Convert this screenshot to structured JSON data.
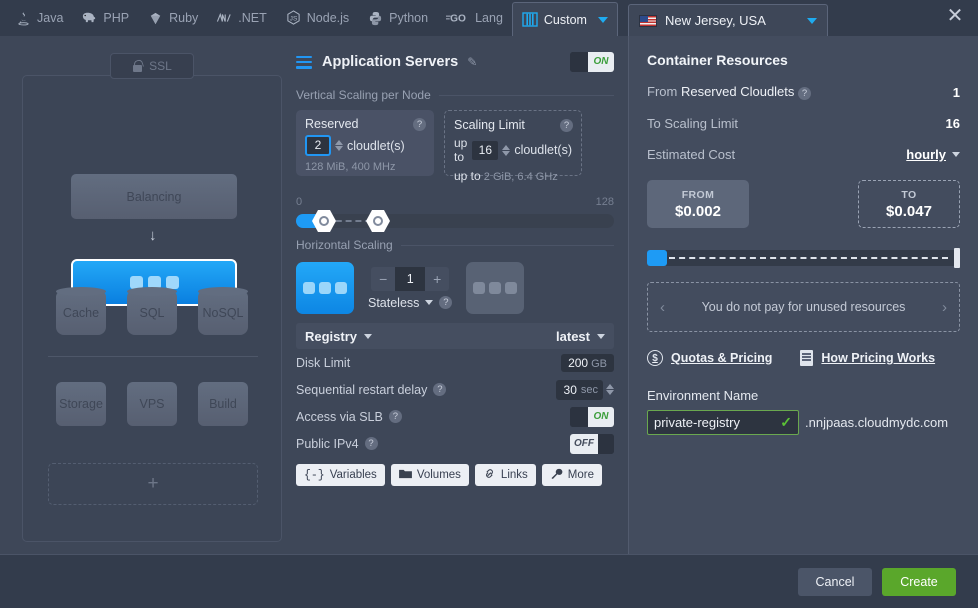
{
  "topbar": {
    "lang_tabs": [
      {
        "label": "Java",
        "icon": "java-icon",
        "active": false
      },
      {
        "label": "PHP",
        "icon": "php-elephant-icon",
        "active": false
      },
      {
        "label": "Ruby",
        "icon": "ruby-gem-icon",
        "active": false
      },
      {
        "label": ".NET",
        "icon": "dotnet-icon",
        "active": false
      },
      {
        "label": "Node.js",
        "icon": "nodejs-icon",
        "active": false
      },
      {
        "label": "Python",
        "icon": "python-icon",
        "active": false
      },
      {
        "label": "Lang",
        "icon": "go-icon",
        "active": false
      },
      {
        "label": "Custom",
        "icon": "custom-containers-icon",
        "active": true
      }
    ],
    "region": {
      "label": "New Jersey, USA",
      "icon": "usa-flag-icon"
    },
    "close_label": "✕"
  },
  "topology": {
    "ssl_badge": "SSL",
    "balancing": "Balancing",
    "app_server_node": "application-servers-node",
    "databases": [
      "Cache",
      "SQL",
      "NoSQL"
    ],
    "extras": [
      "Storage",
      "VPS",
      "Build"
    ],
    "add_label": "+"
  },
  "center": {
    "title": "Application Servers",
    "toggle_on": "ON",
    "vertical": {
      "section": "Vertical Scaling per Node",
      "reserved": {
        "title": "Reserved",
        "value": "2",
        "unit": "cloudlet(s)",
        "dimensions": "128 MiB, 400 MHz",
        "help": "?"
      },
      "limit": {
        "title": "Scaling Limit",
        "prefix": "up to",
        "value": "16",
        "unit": "cloudlet(s)",
        "dimensions_prefix": "up to",
        "dimensions": "2 GiB, 6.4 GHz",
        "help": "?"
      },
      "slider_min": "0",
      "slider_max": "128"
    },
    "horizontal": {
      "section": "Horizontal Scaling",
      "count": "1",
      "minus": "−",
      "plus": "+",
      "mode": "Stateless",
      "help": "?"
    },
    "registry": {
      "label": "Registry",
      "tag": "latest"
    },
    "rows": [
      {
        "label": "Disk Limit",
        "value": "200",
        "unit": "GB",
        "help": false
      },
      {
        "label": "Sequential restart delay",
        "value": "30",
        "unit": "sec",
        "help": true
      },
      {
        "label": "Access via SLB",
        "toggle": "ON",
        "help": true
      },
      {
        "label": "Public IPv4",
        "toggle": "OFF",
        "help": true
      }
    ],
    "buttons": [
      {
        "label": "Variables",
        "icon": "braces-icon"
      },
      {
        "label": "Volumes",
        "icon": "folder-icon"
      },
      {
        "label": "Links",
        "icon": "link-icon"
      },
      {
        "label": "More",
        "icon": "wrench-icon"
      }
    ]
  },
  "right": {
    "title": "Container Resources",
    "from_label_light": "From ",
    "from_label_bold": "Reserved Cloudlets",
    "from_value": "1",
    "to_label": "To Scaling Limit",
    "to_value": "16",
    "cost_label": "Estimated Cost",
    "cost_period": "hourly",
    "cost_from_label": "FROM",
    "cost_from_value": "$0.002",
    "cost_to_label": "TO",
    "cost_to_value": "$0.047",
    "unused_text": "You do not pay for unused resources",
    "prev_arrow": "‹",
    "next_arrow": "›",
    "quotas_link": "Quotas & Pricing",
    "pricing_link": "How Pricing Works",
    "env_label": "Environment Name",
    "env_value": "private-registry",
    "env_check": "✓",
    "env_suffix": ".nnjpaas.cloudmydc.com"
  },
  "footer": {
    "cancel": "Cancel",
    "create": "Create"
  },
  "colors": {
    "accent_blue": "#1e9bf5",
    "create_green": "#5aa72b",
    "status_on_green": "#3b9e3b",
    "panel_bg": "#434c5e",
    "window_bg": "#3e4758"
  }
}
